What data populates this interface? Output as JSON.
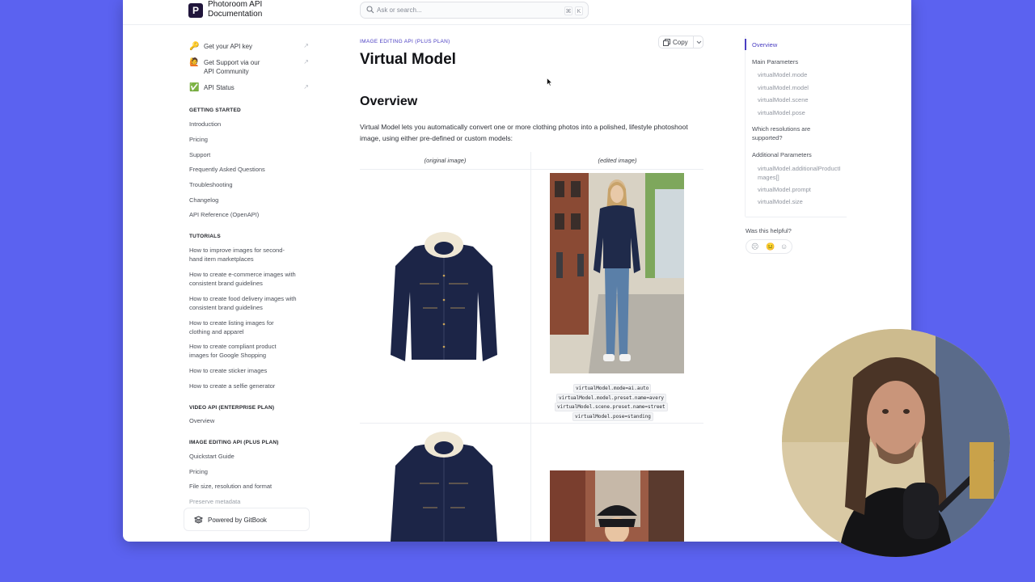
{
  "header": {
    "logo_letter": "P",
    "site_title": "Photoroom API Documentation",
    "search_placeholder": "Ask or search...",
    "shortcut_keys": [
      "⌘",
      "K"
    ]
  },
  "nav": {
    "external_links": [
      {
        "icon": "key-icon",
        "emoji": "🔑",
        "label": "Get your API key"
      },
      {
        "icon": "raised-hand-icon",
        "emoji": "🙋",
        "label": "Get Support via our API Community"
      },
      {
        "icon": "check-mark-icon",
        "emoji": "✅",
        "label": "API Status"
      }
    ],
    "sections": [
      {
        "title": "GETTING STARTED",
        "items": [
          "Introduction",
          "Pricing",
          "Support",
          "Frequently Asked Questions",
          "Troubleshooting",
          "Changelog",
          "API Reference (OpenAPI)"
        ]
      },
      {
        "title": "TUTORIALS",
        "items": [
          "How to improve images for second-hand item marketplaces",
          "How to create e-commerce images with consistent brand guidelines",
          "How to create food delivery images with consistent brand guidelines",
          "How to create listing images for clothing and apparel",
          "How to create compliant product images for Google Shopping",
          "How to create sticker images",
          "How to create a selfie generator"
        ]
      },
      {
        "title": "VIDEO API (ENTERPRISE PLAN)",
        "items": [
          "Overview"
        ]
      },
      {
        "title": "IMAGE EDITING API (PLUS PLAN)",
        "items": [
          "Quickstart Guide",
          "Pricing",
          "File size, resolution and format",
          "Preserve metadata"
        ]
      }
    ],
    "powered_by": "Powered by GitBook"
  },
  "main": {
    "breadcrumb": "IMAGE EDITING API (PLUS PLAN)",
    "title": "Virtual Model",
    "copy_label": "Copy",
    "overview_heading": "Overview",
    "overview_text": "Virtual Model lets you automatically convert one or more clothing photos into a polished, lifestyle photoshoot image, using either pre-defined or custom models:",
    "table": {
      "headers": [
        "(original image)",
        "(edited image)"
      ],
      "row1_params": [
        "virtualModel.mode=ai.auto",
        "virtualModel.model.preset.name=avery",
        "virtualModel.scene.preset.name=street",
        "virtualModel.pose=standing"
      ]
    }
  },
  "toc": {
    "items": [
      {
        "label": "Overview",
        "type": "active"
      },
      {
        "label": "Main Parameters",
        "type": "main"
      },
      {
        "label": "virtualModel.mode",
        "type": "sub"
      },
      {
        "label": "virtualModel.model",
        "type": "sub"
      },
      {
        "label": "virtualModel.scene",
        "type": "sub"
      },
      {
        "label": "virtualModel.pose",
        "type": "sub"
      },
      {
        "label": "Which resolutions are supported?",
        "type": "main"
      },
      {
        "label": "Additional Parameters",
        "type": "main"
      },
      {
        "label": "virtualModel.additionalProductImages[]",
        "type": "sub"
      },
      {
        "label": "virtualModel.prompt",
        "type": "sub"
      },
      {
        "label": "virtualModel.size",
        "type": "sub"
      }
    ],
    "helpful_label": "Was this helpful?",
    "feedback_faces": [
      "☹",
      "😐",
      "☺"
    ]
  },
  "colors": {
    "background": "#5b62f0",
    "accent": "#4a3ec2",
    "logo": "#20153b"
  }
}
